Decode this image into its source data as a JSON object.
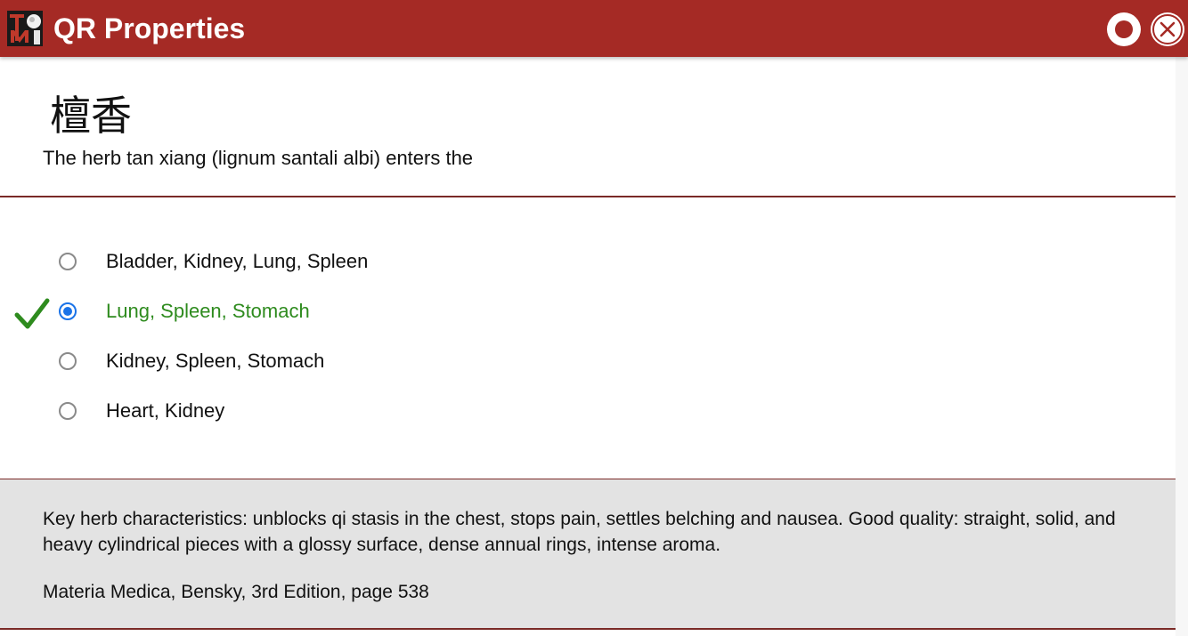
{
  "app": {
    "title": "QR Properties"
  },
  "question": {
    "herb_chinese": "檀香",
    "prompt": "The herb tan xiang (lignum santali albi) enters the"
  },
  "options": [
    {
      "label": "Bladder, Kidney, Lung, Spleen",
      "selected": false,
      "correct": false
    },
    {
      "label": "Lung, Spleen, Stomach",
      "selected": true,
      "correct": true
    },
    {
      "label": "Kidney, Spleen, Stomach",
      "selected": false,
      "correct": false
    },
    {
      "label": "Heart, Kidney",
      "selected": false,
      "correct": false
    }
  ],
  "explanation": {
    "text": "Key herb characteristics: unblocks qi stasis in the chest, stops pain, settles belching and nausea. Good quality: straight, solid, and heavy cylindrical pieces with a glossy surface, dense annual rings, intense aroma.",
    "reference": "Materia Medica, Bensky, 3rd Edition, page 538"
  },
  "icons": {
    "logo": "tcm-tests-logo",
    "record": "record-icon",
    "close": "close-icon",
    "correct": "checkmark-icon"
  },
  "colors": {
    "titlebar": "#a52a25",
    "correct_text": "#2e8b1e",
    "radio_selected": "#1a73e8",
    "explanation_bg": "#e3e3e3",
    "divider": "#7a2a27"
  }
}
